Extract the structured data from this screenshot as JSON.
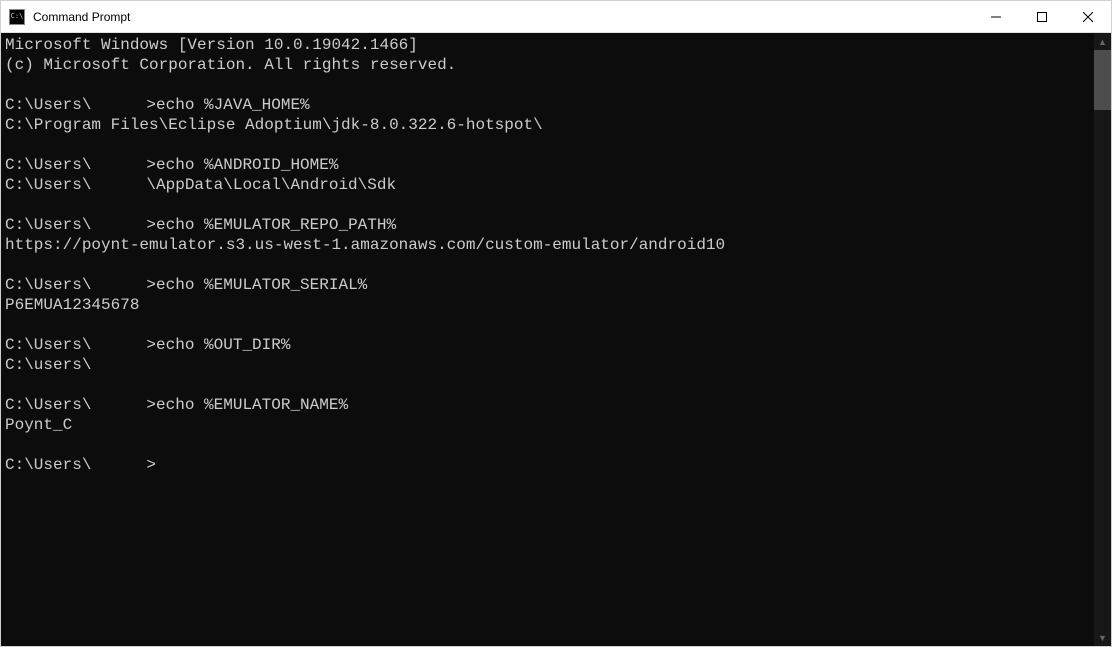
{
  "window": {
    "title": "Command Prompt"
  },
  "terminal": {
    "header_line1": "Microsoft Windows [Version 10.0.19042.1466]",
    "header_line2": "(c) Microsoft Corporation. All rights reserved.",
    "user_path_prefix": "C:\\Users\\",
    "prompt_suffix": ">",
    "commands": [
      {
        "cmd": "echo %JAVA_HOME%",
        "output": "C:\\Program Files\\Eclipse Adoptium\\jdk-8.0.322.6-hotspot\\"
      },
      {
        "cmd": "echo %ANDROID_HOME%",
        "output_prefix": "C:\\Users\\",
        "output_suffix": "\\AppData\\Local\\Android\\Sdk"
      },
      {
        "cmd": "echo %EMULATOR_REPO_PATH%",
        "output": "https://poynt-emulator.s3.us-west-1.amazonaws.com/custom-emulator/android10"
      },
      {
        "cmd": "echo %EMULATOR_SERIAL%",
        "output": "P6EMUA12345678"
      },
      {
        "cmd": "echo %OUT_DIR%",
        "output_prefix": "C:\\users\\",
        "output_suffix": ""
      },
      {
        "cmd": "echo %EMULATOR_NAME%",
        "output": "Poynt_C"
      }
    ]
  }
}
